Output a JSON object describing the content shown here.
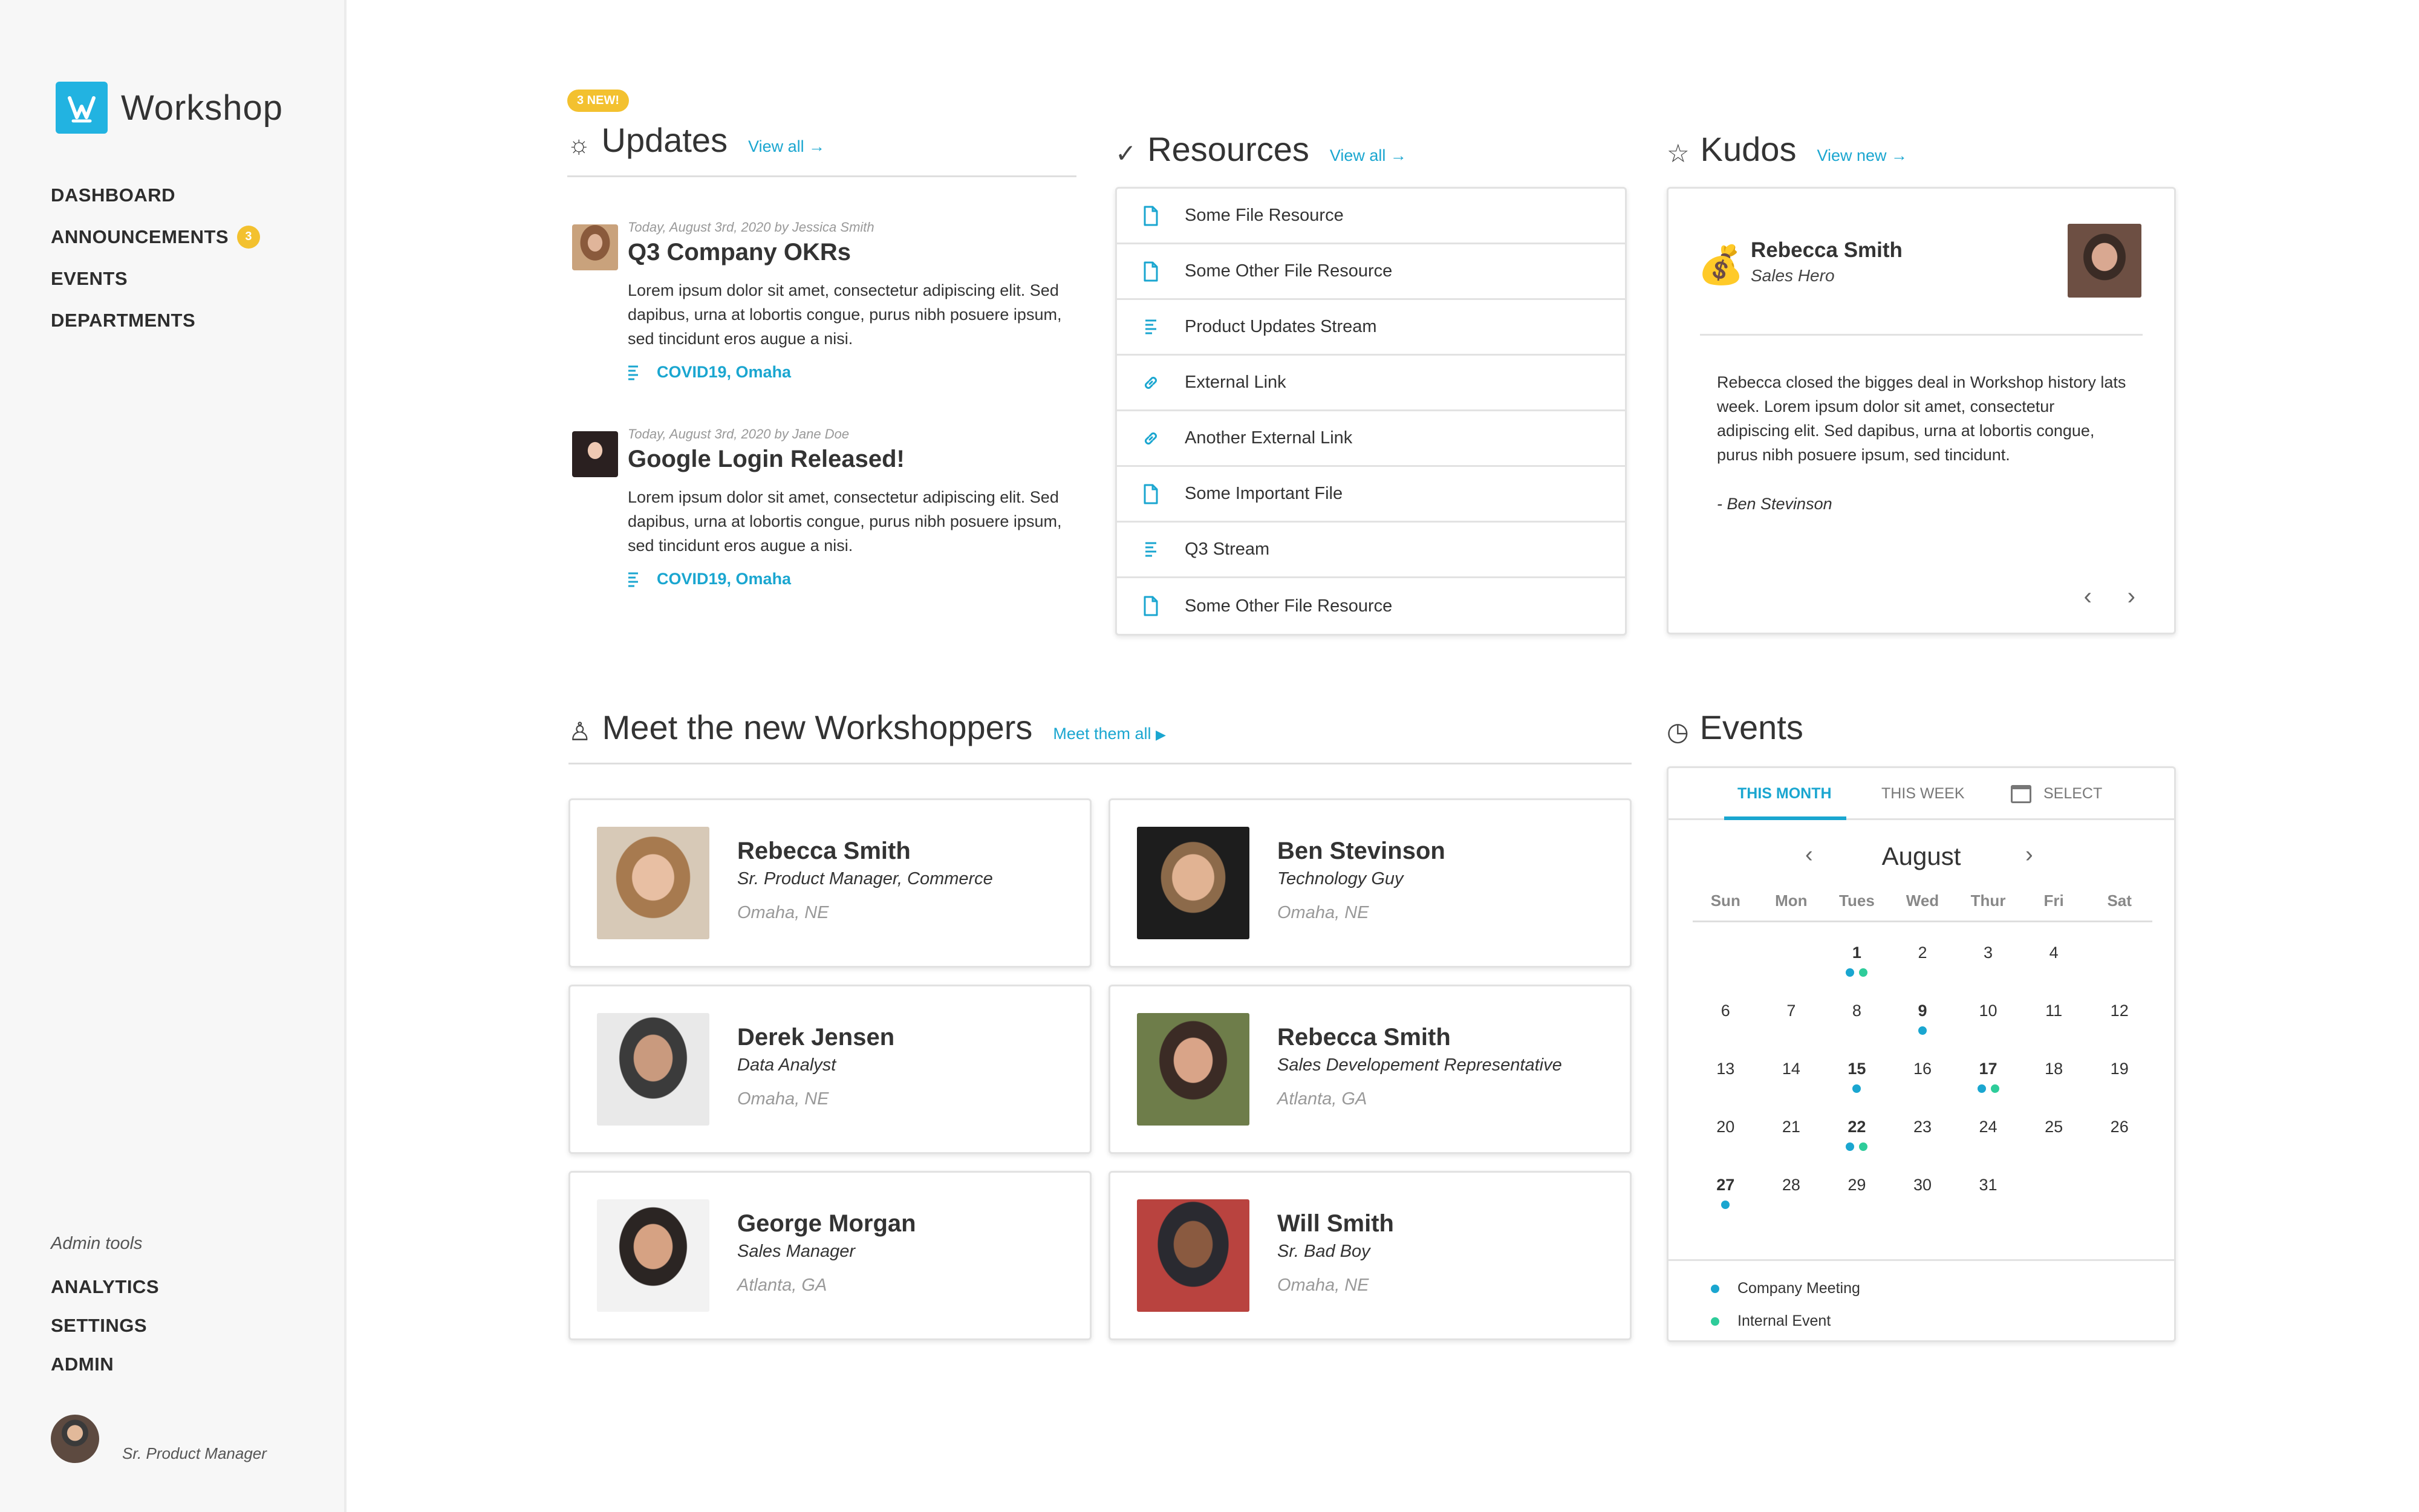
{
  "app": {
    "name": "Workshop"
  },
  "colors": {
    "accent": "#1aa6d0",
    "brand": "#22b3e1",
    "badge": "#f3c12f",
    "company_meeting": "#1aa6d0",
    "internal_event": "#2ecc9a"
  },
  "sidebar": {
    "nav": [
      {
        "label": "DASHBOARD"
      },
      {
        "label": "ANNOUNCEMENTS",
        "badge": "3"
      },
      {
        "label": "EVENTS"
      },
      {
        "label": "DEPARTMENTS"
      }
    ],
    "admin_label": "Admin tools",
    "admin_nav": [
      {
        "label": "ANALYTICS"
      },
      {
        "label": "SETTINGS"
      },
      {
        "label": "ADMIN"
      }
    ],
    "user": {
      "role": "Sr. Product Manager"
    }
  },
  "updates": {
    "badge": "3 NEW!",
    "title": "Updates",
    "link": "View all →",
    "icon": "sun-icon",
    "items": [
      {
        "meta": "Today, August 3rd, 2020 by Jessica Smith",
        "title": "Q3 Company OKRs",
        "body": "Lorem ipsum dolor sit amet, consectetur adipiscing elit. Sed dapibus, urna at lobortis congue, purus nibh posuere ipsum, sed tincidunt eros augue a nisi.",
        "tags": "COVID19, Omaha"
      },
      {
        "meta": "Today, August 3rd, 2020 by Jane Doe",
        "title": "Google Login Released!",
        "body": "Lorem ipsum dolor sit amet, consectetur adipiscing elit. Sed dapibus, urna at lobortis congue, purus nibh posuere ipsum, sed tincidunt eros augue a nisi.",
        "tags": "COVID19, Omaha"
      }
    ]
  },
  "resources": {
    "title": "Resources",
    "link": "View all →",
    "icon": "checkmark-icon",
    "items": [
      {
        "label": "Some File Resource",
        "icon": "file-icon"
      },
      {
        "label": "Some Other File Resource",
        "icon": "file-icon"
      },
      {
        "label": "Product Updates Stream",
        "icon": "stream-icon"
      },
      {
        "label": "External Link",
        "icon": "link-icon"
      },
      {
        "label": "Another External Link",
        "icon": "link-icon"
      },
      {
        "label": "Some Important File",
        "icon": "file-icon"
      },
      {
        "label": "Q3 Stream",
        "icon": "stream-icon"
      },
      {
        "label": "Some Other File Resource",
        "icon": "file-icon"
      }
    ]
  },
  "kudos": {
    "title": "Kudos",
    "link": "View new →",
    "icon": "star-icon",
    "card": {
      "name": "Rebecca Smith",
      "role": "Sales Hero",
      "text": "Rebecca closed the bigges deal in Workshop history lats week. Lorem ipsum dolor sit amet, consectetur adipiscing elit. Sed dapibus, urna at lobortis congue, purus nibh posuere ipsum, sed tincidunt.",
      "signature": "- Ben Stevinson"
    }
  },
  "workshoppers": {
    "title": "Meet the new Workshoppers",
    "link": "Meet them all",
    "icon": "person-icon",
    "people": [
      {
        "name": "Rebecca Smith",
        "role": "Sr. Product Manager, Commerce",
        "location": "Omaha, NE"
      },
      {
        "name": "Ben Stevinson",
        "role": "Technology Guy",
        "location": "Omaha, NE"
      },
      {
        "name": "Derek Jensen",
        "role": "Data Analyst",
        "location": "Omaha, NE"
      },
      {
        "name": "Rebecca Smith",
        "role": "Sales Developement Representative",
        "location": "Atlanta, GA"
      },
      {
        "name": "George Morgan",
        "role": "Sales Manager",
        "location": "Atlanta, GA"
      },
      {
        "name": "Will Smith",
        "role": "Sr. Bad Boy",
        "location": "Omaha, NE"
      }
    ]
  },
  "events": {
    "title": "Events",
    "icon": "clock-icon",
    "tabs": {
      "month": "THIS MONTH",
      "week": "THIS WEEK",
      "select": "SELECT"
    },
    "month": "August",
    "weekdays": [
      "Sun",
      "Mon",
      "Tues",
      "Wed",
      "Thur",
      "Fri",
      "Sat"
    ],
    "days": [
      {
        "d": "",
        "e": []
      },
      {
        "d": "",
        "e": []
      },
      {
        "d": "1",
        "e": [
          "meeting",
          "internal"
        ]
      },
      {
        "d": "2",
        "e": []
      },
      {
        "d": "3",
        "e": []
      },
      {
        "d": "4",
        "e": []
      },
      {
        "d": "",
        "e": []
      },
      {
        "d": "6",
        "e": []
      },
      {
        "d": "7",
        "e": []
      },
      {
        "d": "8",
        "e": []
      },
      {
        "d": "9",
        "e": [
          "meeting"
        ]
      },
      {
        "d": "10",
        "e": []
      },
      {
        "d": "11",
        "e": []
      },
      {
        "d": "12",
        "e": []
      },
      {
        "d": "13",
        "e": []
      },
      {
        "d": "14",
        "e": []
      },
      {
        "d": "15",
        "e": [
          "meeting"
        ]
      },
      {
        "d": "16",
        "e": []
      },
      {
        "d": "17",
        "e": [
          "meeting",
          "internal"
        ]
      },
      {
        "d": "18",
        "e": []
      },
      {
        "d": "19",
        "e": []
      },
      {
        "d": "20",
        "e": []
      },
      {
        "d": "21",
        "e": []
      },
      {
        "d": "22",
        "e": [
          "meeting",
          "internal"
        ]
      },
      {
        "d": "23",
        "e": []
      },
      {
        "d": "24",
        "e": []
      },
      {
        "d": "25",
        "e": []
      },
      {
        "d": "26",
        "e": []
      },
      {
        "d": "27",
        "e": [
          "meeting"
        ]
      },
      {
        "d": "28",
        "e": []
      },
      {
        "d": "29",
        "e": []
      },
      {
        "d": "30",
        "e": []
      },
      {
        "d": "31",
        "e": []
      }
    ],
    "legend": {
      "meeting": "Company Meeting",
      "internal": "Internal Event"
    }
  }
}
